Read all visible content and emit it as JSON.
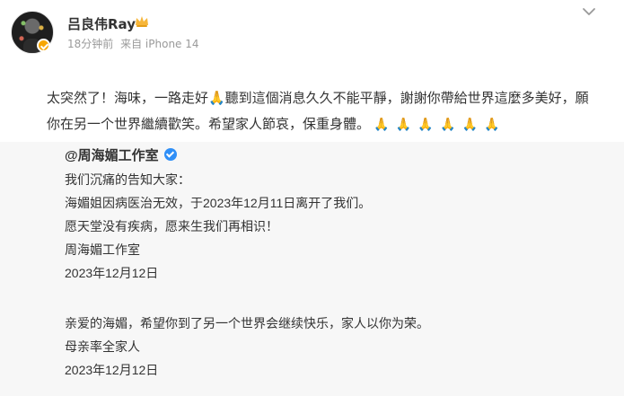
{
  "post": {
    "username": "吕良伟Ray",
    "time": "18分钟前",
    "source": "来自 iPhone 14",
    "text": "太突然了！海味，一路走好🙏聽到這個消息久久不能平靜，謝謝你帶給世界這麼多美好，願你在另一个世界繼續歡笑。希望家人節哀，保重身體。",
    "emojis": [
      "🙏",
      "🙏",
      "🙏",
      "🙏",
      "🙏",
      "🙏"
    ],
    "more_icon": "chevron-down-icon",
    "avatar_icon": "user-avatar",
    "vip_icon": "crown-icon",
    "verify_color": "#f7a600"
  },
  "repost": {
    "author": "@周海媚工作室",
    "verify_color": "#2f8ff7",
    "lines": [
      "我们沉痛的告知大家：",
      "海媚姐因病医治无效，于2023年12月11日离开了我们。",
      "愿天堂没有疾病，愿来生我们再相识！",
      "周海媚工作室",
      "2023年12月12日",
      "",
      "亲爱的海媚，希望你到了另一个世界会继续快乐，家人以你为荣。",
      "母亲率全家人",
      "2023年12月12日"
    ]
  }
}
